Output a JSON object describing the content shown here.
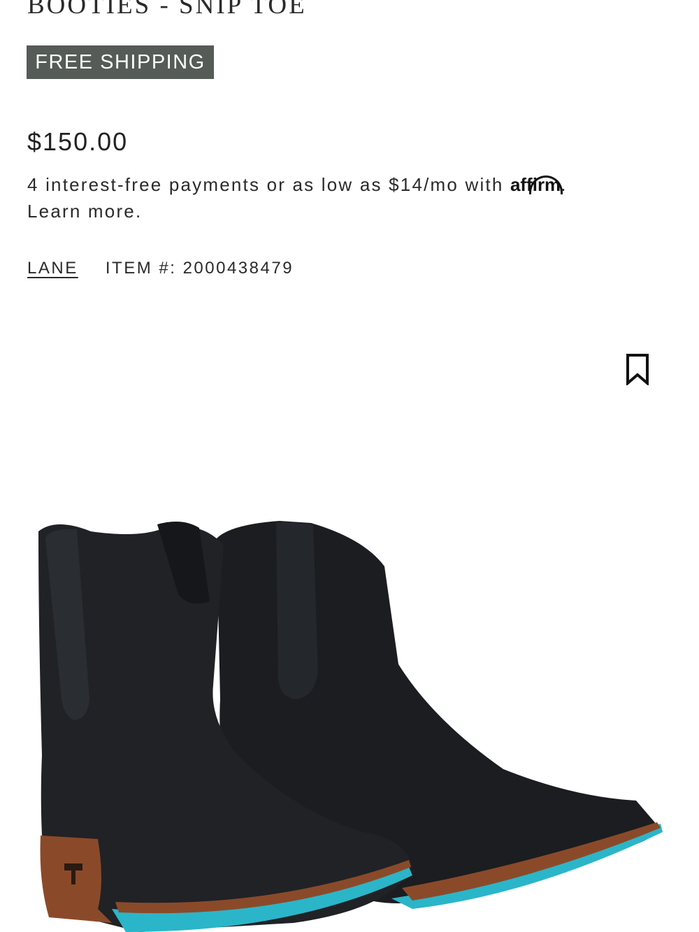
{
  "product": {
    "title": "BOOTIES - SNIP TOE",
    "shipping_badge": "FREE SHIPPING",
    "price": "$150.00",
    "financing": {
      "text": "4 interest-free payments or as low as $14/mo with ",
      "logo_text": "affirm",
      "after_logo": ".",
      "learn_more": "Learn more."
    },
    "brand": "LANE",
    "item_label": "ITEM #:",
    "item_number": "2000438479",
    "bookmark_icon": "bookmark-icon",
    "image_icon": "boots-image"
  },
  "colors": {
    "badge_bg": "#555b57",
    "badge_text": "#ffffff",
    "text": "#2a2a2a",
    "sole_accent": "#2bb5c9",
    "heel": "#8a4a2a"
  }
}
